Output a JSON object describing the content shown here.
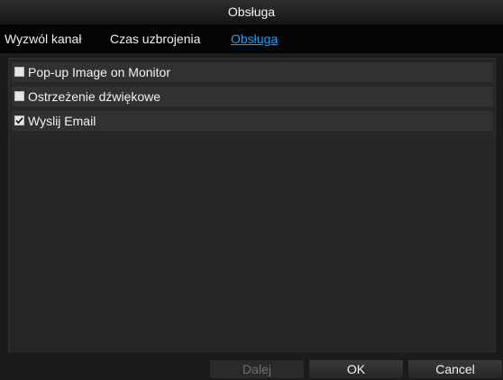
{
  "dialog": {
    "title": "Obsługa"
  },
  "tabs": [
    {
      "label": "Wyzwól kanał",
      "active": false
    },
    {
      "label": "Czas uzbrojenia",
      "active": false
    },
    {
      "label": "Obsługa",
      "active": true
    }
  ],
  "options": [
    {
      "label": "Pop-up Image on Monitor",
      "checked": false
    },
    {
      "label": "Ostrzeżenie dźwiękowe",
      "checked": false
    },
    {
      "label": "Wyslij Email",
      "checked": true
    }
  ],
  "buttons": {
    "next_label": "Dalej",
    "ok_label": "OK",
    "cancel_label": "Cancel"
  },
  "colors": {
    "accent": "#1aa0ff",
    "background": "#1b1b1b",
    "panel": "#262626"
  },
  "icons": {
    "check": "checkmark-icon"
  }
}
